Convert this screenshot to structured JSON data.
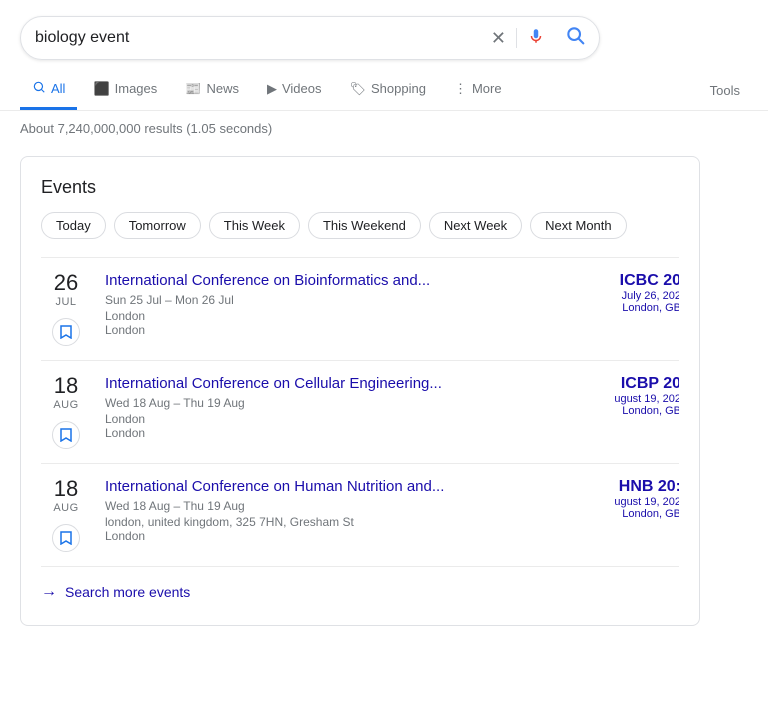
{
  "search": {
    "query": "biology event",
    "clear_label": "×",
    "search_label": "🔍",
    "placeholder": "biology event"
  },
  "nav": {
    "tabs": [
      {
        "id": "all",
        "label": "All",
        "icon": "🔍",
        "active": true
      },
      {
        "id": "images",
        "label": "Images",
        "icon": "🖼",
        "active": false
      },
      {
        "id": "news",
        "label": "News",
        "icon": "📰",
        "active": false
      },
      {
        "id": "videos",
        "label": "Videos",
        "icon": "▶",
        "active": false
      },
      {
        "id": "shopping",
        "label": "Shopping",
        "icon": "🏷",
        "active": false
      },
      {
        "id": "more",
        "label": "More",
        "icon": "⋮",
        "active": false
      }
    ],
    "tools_label": "Tools"
  },
  "results_count": "About 7,240,000,000 results (1.05 seconds)",
  "events": {
    "title": "Events",
    "filters": [
      "Today",
      "Tomorrow",
      "This Week",
      "This Weekend",
      "Next Week",
      "Next Month"
    ],
    "items": [
      {
        "day": "26",
        "month": "JUL",
        "name": "International Conference on Bioinformatics and...",
        "dates": "Sun 25 Jul – Mon 26 Jul",
        "location1": "London",
        "location2": "London",
        "badge_title": "ICBC 20",
        "badge_date": "July 26, 202",
        "badge_loc": "London, GB"
      },
      {
        "day": "18",
        "month": "AUG",
        "name": "International Conference on Cellular Engineering...",
        "dates": "Wed 18 Aug – Thu 19 Aug",
        "location1": "London",
        "location2": "London",
        "badge_title": "ICBP 20",
        "badge_date": "ugust 19, 202",
        "badge_loc": "London, GB"
      },
      {
        "day": "18",
        "month": "AUG",
        "name": "International Conference on Human Nutrition and...",
        "dates": "Wed 18 Aug – Thu 19 Aug",
        "location1": "london, united kingdom, 325 7HN, Gresham St",
        "location2": "London",
        "badge_title": "HNB 20:",
        "badge_date": "ugust 19, 202",
        "badge_loc": "London, GB"
      }
    ],
    "more_events_label": "Search more events"
  }
}
